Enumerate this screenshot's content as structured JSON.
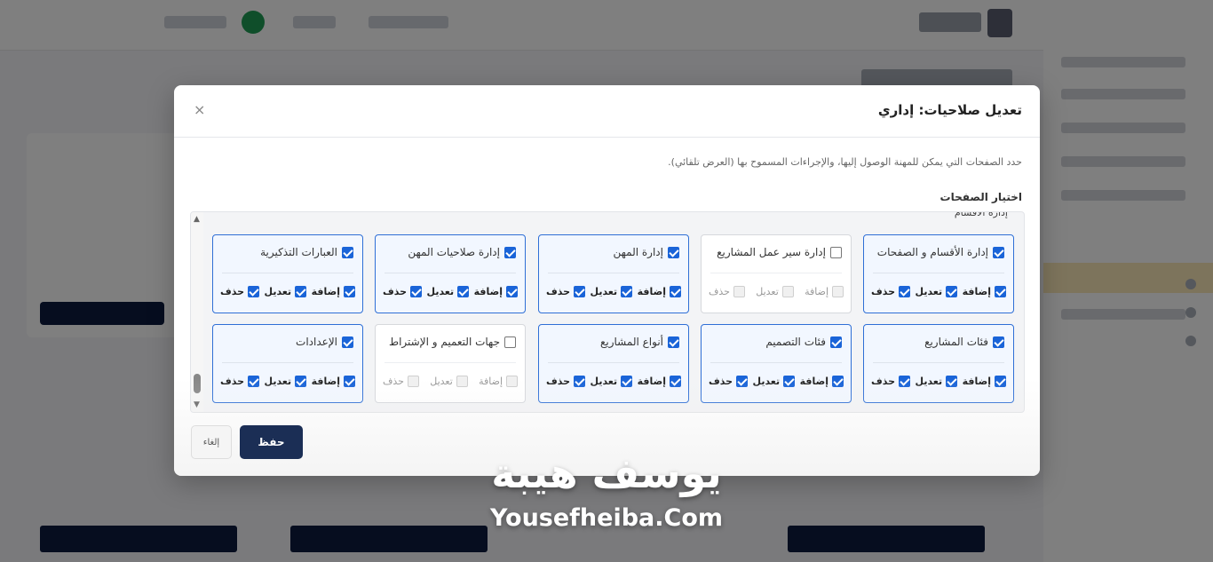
{
  "modal": {
    "title": "تعديل صلاحيات: إداري",
    "close_label": "×",
    "description": "حدد الصفحات التي يمكن للمهنة الوصول إليها، والإجراءات المسموح بها (العرض تلقائي).",
    "section_label": "اختيار الصفحات",
    "cut_label": "إدارة الأقسام",
    "save_label": "حفظ",
    "cancel_label": "إلغاء"
  },
  "pages": [
    {
      "name": "إدارة الأقسام و الصفحات",
      "checked": true,
      "add": true,
      "edit": true,
      "del": true
    },
    {
      "name": "إدارة سير عمل المشاريع",
      "checked": false,
      "add": false,
      "edit": false,
      "del": false
    },
    {
      "name": "إدارة المهن",
      "checked": true,
      "add": true,
      "edit": true,
      "del": true
    },
    {
      "name": "إدارة صلاحيات المهن",
      "checked": true,
      "add": true,
      "edit": true,
      "del": true
    },
    {
      "name": "العبارات التذكيرية",
      "checked": true,
      "add": true,
      "edit": true,
      "del": true
    },
    {
      "name": "فئات المشاريع",
      "checked": true,
      "add": true,
      "edit": true,
      "del": true
    },
    {
      "name": "فئات التصميم",
      "checked": true,
      "add": true,
      "edit": true,
      "del": true
    },
    {
      "name": "أنواع المشاريع",
      "checked": true,
      "add": true,
      "edit": true,
      "del": true
    },
    {
      "name": "جهات التعميم و الإشتراط",
      "checked": false,
      "add": false,
      "edit": false,
      "del": false
    },
    {
      "name": "الإعدادات",
      "checked": true,
      "add": true,
      "edit": true,
      "del": true
    }
  ],
  "actions": {
    "add": "إضافة",
    "edit": "تعديل",
    "del": "حذف"
  },
  "watermark": {
    "arabic": "يوسف هيبة",
    "english": "Yousefheiba.Com"
  },
  "colors": {
    "accent": "#1a64d8",
    "primary_button": "#1b2e55",
    "card_border": "#2f6fd6"
  }
}
